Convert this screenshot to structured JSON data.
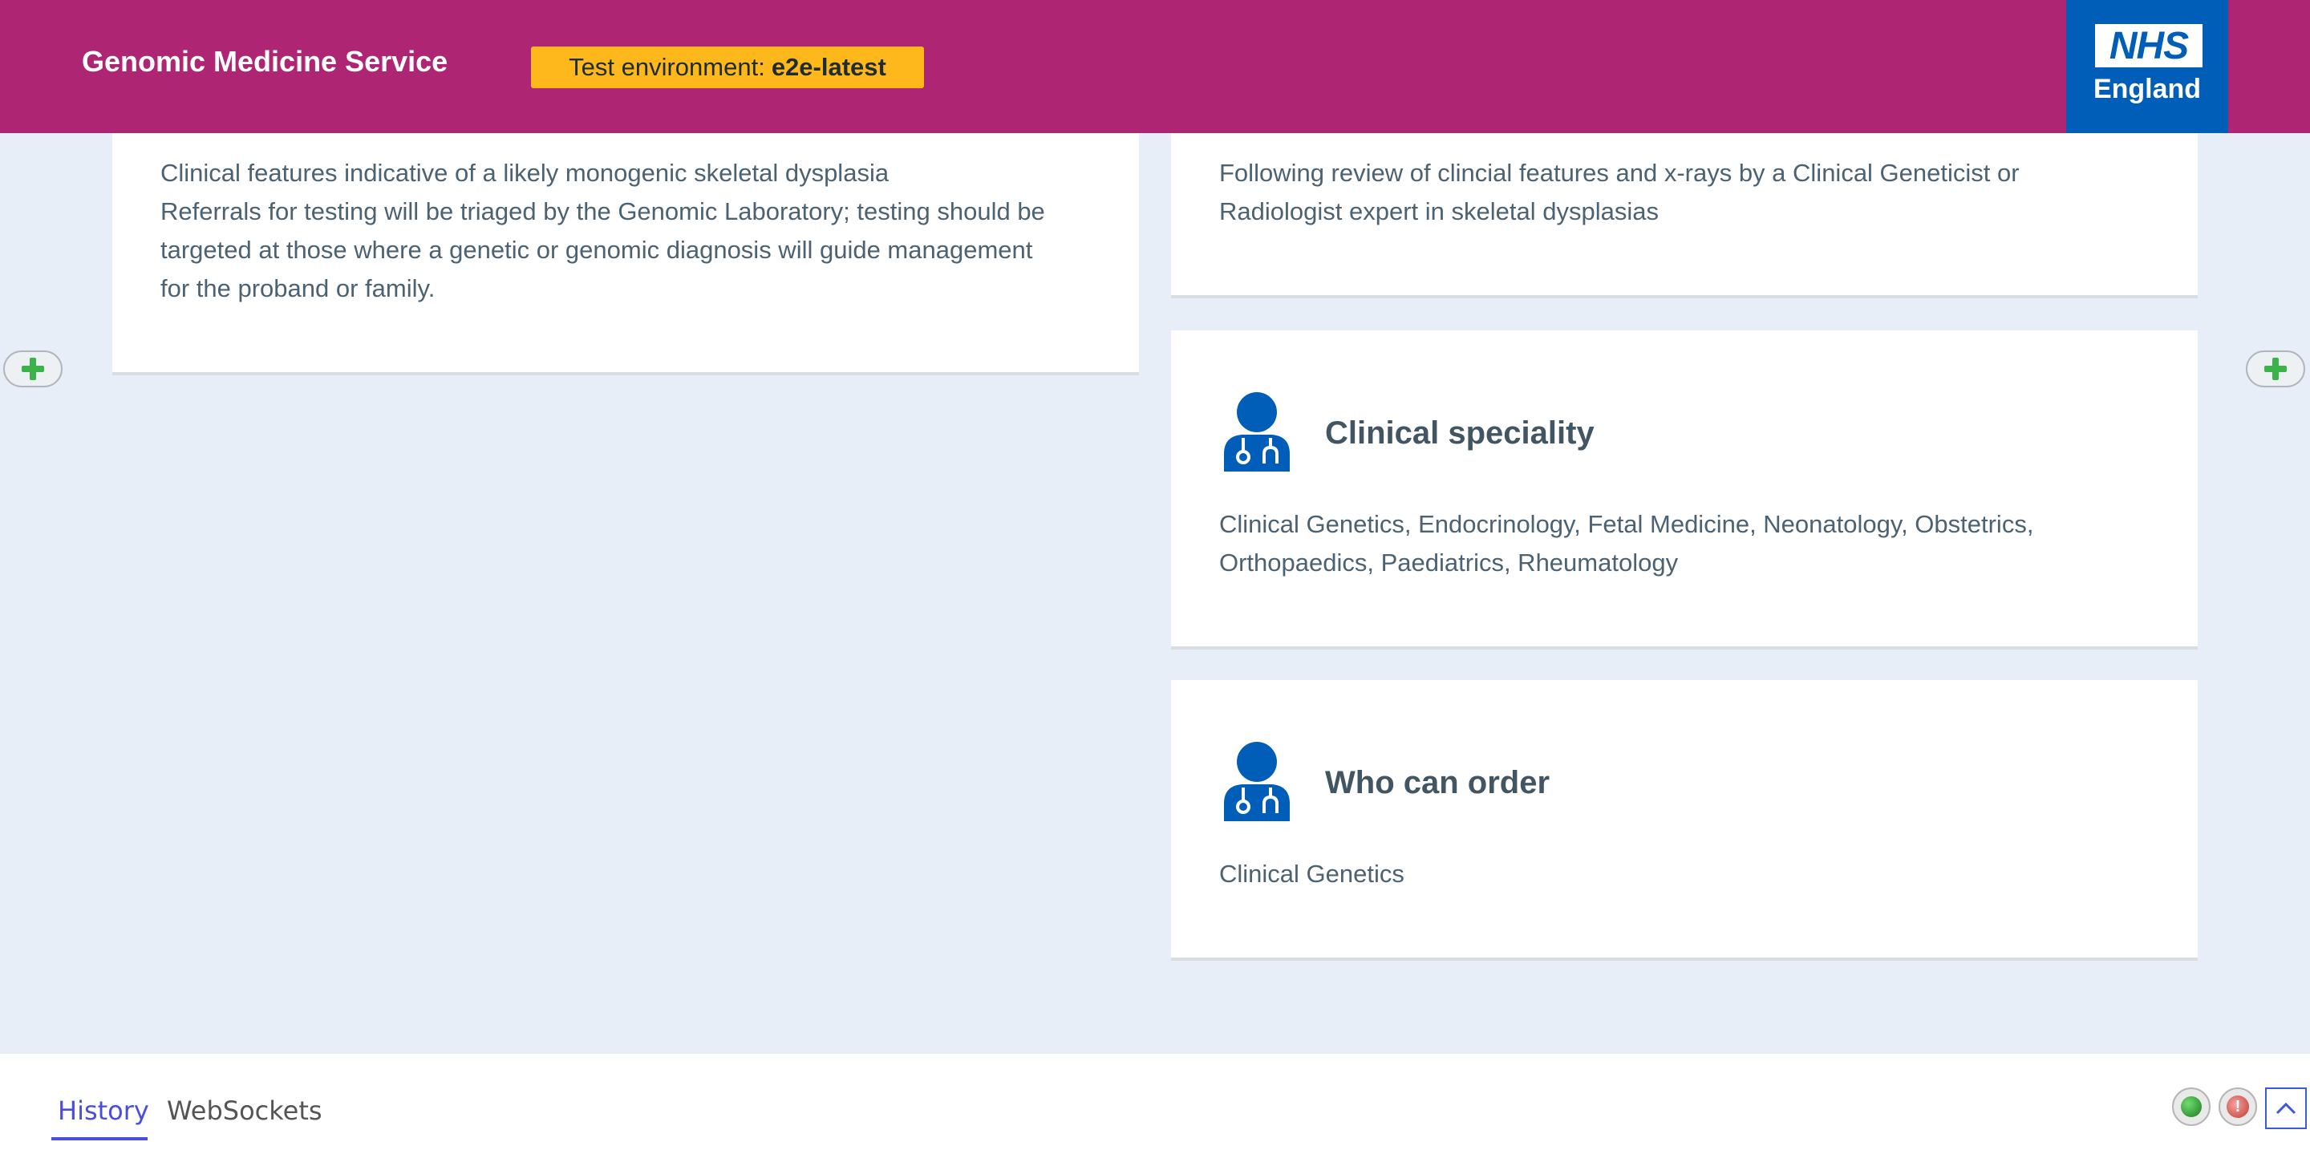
{
  "header": {
    "app_title": "Genomic Medicine Service",
    "env_label": "Test environment:",
    "env_name": "e2e-latest",
    "logo_text": "NHS",
    "logo_subtext": "England",
    "background_color": "#ae2573",
    "logo_background": "#005eb8"
  },
  "cards": {
    "criteria": {
      "lines": [
        "Clinical features indicative of a likely monogenic skeletal dysplasia",
        "Referrals for testing will be triaged by the Genomic Laboratory; testing should be",
        "targeted at those where a genetic or genomic diagnosis will guide management",
        "for the proband or family."
      ]
    },
    "review": {
      "lines": [
        "Following review of clincial features and x-rays by a Clinical Geneticist or",
        "Radiologist expert in skeletal dysplasias"
      ]
    },
    "speciality": {
      "heading": "Clinical speciality",
      "icon": "clinician-icon",
      "lines": [
        "Clinical Genetics, Endocrinology, Fetal Medicine, Neonatology, Obstetrics,",
        "Orthopaedics, Paediatrics, Rheumatology"
      ]
    },
    "who_can_order": {
      "heading": "Who can order",
      "icon": "clinician-icon",
      "lines": [
        "Clinical Genetics"
      ]
    }
  },
  "side_buttons": {
    "left_icon": "plus-icon",
    "right_icon": "plus-icon"
  },
  "bottom_panel": {
    "tabs": [
      {
        "label": "History",
        "active": true
      },
      {
        "label": "WebSockets",
        "active": false
      }
    ],
    "status_icons": [
      "connected-status-icon",
      "error-status-icon"
    ],
    "collapse_icon": "chevron-up-icon",
    "accent_color": "#4a4ee0"
  }
}
